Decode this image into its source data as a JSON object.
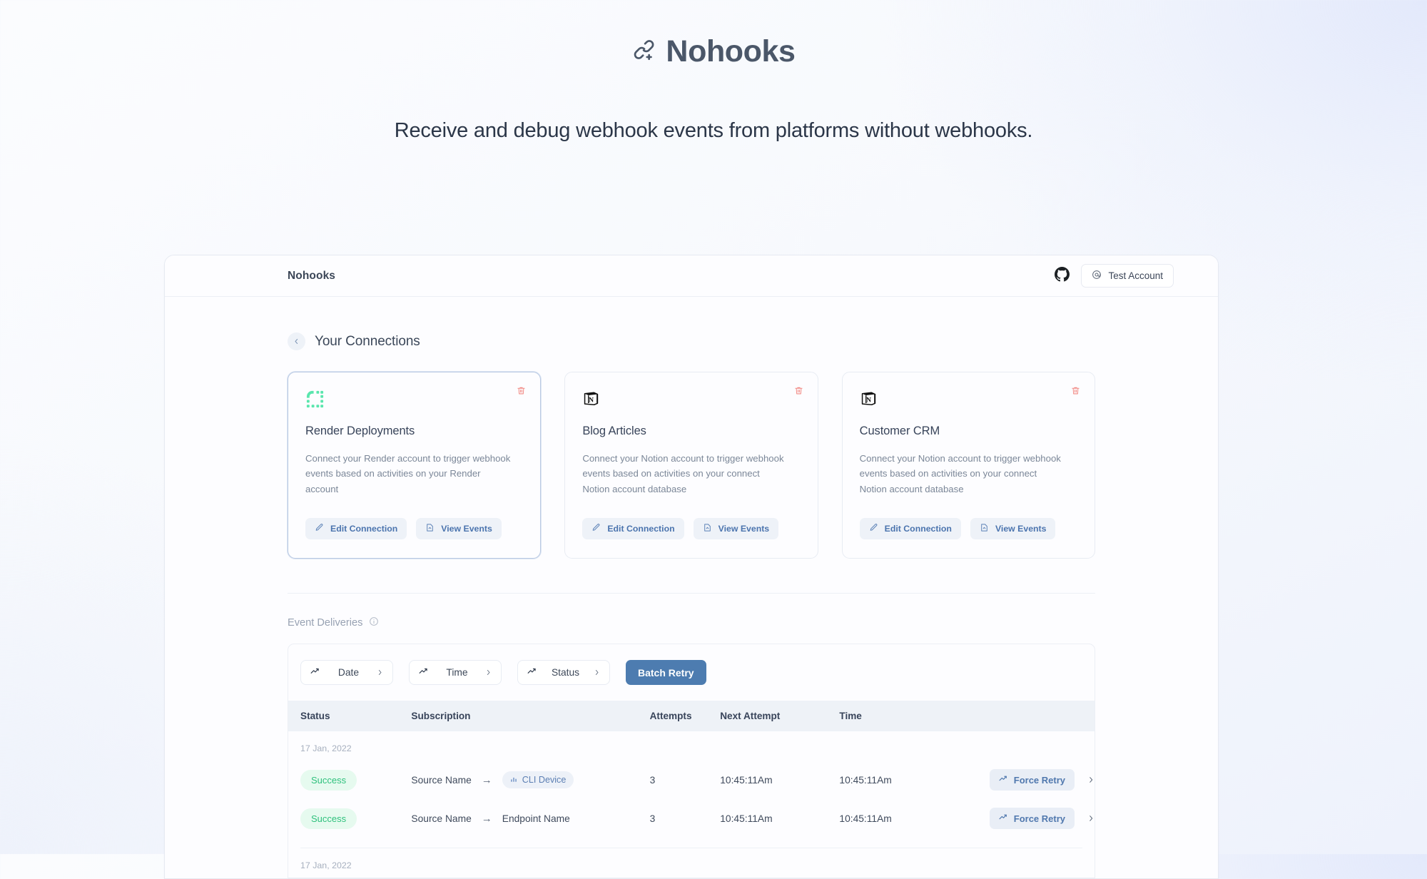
{
  "hero": {
    "logo_icon": "link-plus-icon",
    "brand": "Nohooks",
    "tagline": "Receive and debug webhook events from platforms without webhooks."
  },
  "appbar": {
    "title": "Nohooks",
    "github_icon": "github-icon",
    "account_icon": "at-circle-icon",
    "account_label": "Test Account"
  },
  "connections_section": {
    "back_icon": "chevron-left-icon",
    "title": "Your Connections",
    "cards": [
      {
        "logo_icon": "render-logo-icon",
        "title": "Render Deployments",
        "description": "Connect your Render account to trigger webhook events based on activities on your Render account",
        "edit_label": "Edit Connection",
        "view_label": "View Events",
        "trash_icon": "trash-icon",
        "selected": true
      },
      {
        "logo_icon": "notion-logo-icon",
        "title": "Blog Articles",
        "description": "Connect your Notion account to trigger webhook events based on activities on your connect Notion account database",
        "edit_label": "Edit Connection",
        "view_label": "View Events",
        "trash_icon": "trash-icon",
        "selected": false
      },
      {
        "logo_icon": "notion-logo-icon",
        "title": "Customer CRM",
        "description": "Connect your Notion account to trigger webhook events based on activities on your connect Notion account database",
        "edit_label": "Edit Connection",
        "view_label": "View Events",
        "trash_icon": "trash-icon",
        "selected": false
      }
    ]
  },
  "event_deliveries": {
    "label": "Event Deliveries",
    "info_icon": "info-circle-icon",
    "filters": [
      {
        "icon": "trending-up-icon",
        "label": "Date",
        "chevron": "chevron-right-icon"
      },
      {
        "icon": "trending-up-icon",
        "label": "Time",
        "chevron": "chevron-right-icon"
      },
      {
        "icon": "trending-up-icon",
        "label": "Status",
        "chevron": "chevron-right-icon"
      }
    ],
    "batch_retry_label": "Batch Retry",
    "columns": [
      "Status",
      "Subscription",
      "Attempts",
      "Next Attempt",
      "Time",
      ""
    ],
    "groups": [
      {
        "date": "17 Jan, 2022",
        "rows": [
          {
            "status": "Success",
            "source": "Source Name",
            "arrow": "→",
            "target": "CLI Device",
            "target_is_chip": true,
            "target_icon": "bar-chart-icon",
            "attempts": "3",
            "next_attempt": "10:45:11Am",
            "time": "10:45:11Am",
            "action_icon": "trending-up-icon",
            "action_label": "Force Retry",
            "chevron": "chevron-right-icon"
          },
          {
            "status": "Success",
            "source": "Source Name",
            "arrow": "→",
            "target": "Endpoint Name",
            "target_is_chip": false,
            "target_icon": "",
            "attempts": "3",
            "next_attempt": "10:45:11Am",
            "time": "10:45:11Am",
            "action_icon": "trending-up-icon",
            "action_label": "Force Retry",
            "chevron": "chevron-right-icon"
          }
        ]
      },
      {
        "date": "17 Jan, 2022",
        "rows": []
      }
    ]
  },
  "colors": {
    "accent_blue": "#4d7cb0",
    "link_blue": "#5078ae",
    "success_text": "#2fc17d",
    "success_bg": "#e6faef",
    "danger": "#f08080",
    "render_green": "#5ae6ad",
    "heading": "#3b4759"
  }
}
